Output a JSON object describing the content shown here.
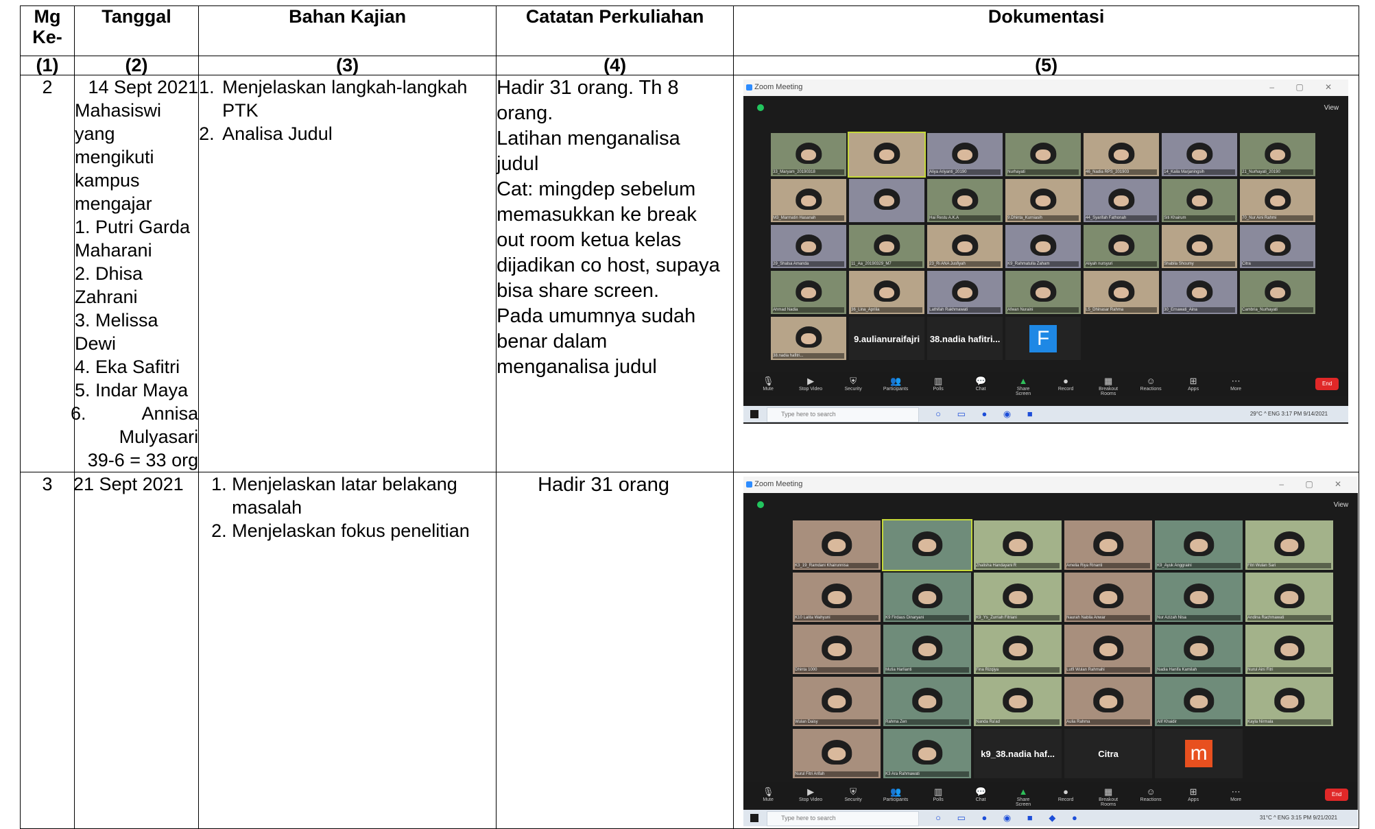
{
  "table": {
    "headers": [
      "Mg Ke-",
      "Tanggal",
      "Bahan Kajian",
      "Catatan Perkuliahan",
      "Dokumentasi"
    ],
    "col_numbers": [
      "(1)",
      "(2)",
      "(3)",
      "(4)",
      "(5)"
    ],
    "rows": [
      {
        "mg": "2",
        "tanggal_lines": [
          "14 Sept 2021",
          "Mahasiswi",
          "yang mengikuti",
          "kampus",
          "mengajar",
          "1. Putri Garda",
          "Maharani",
          "2. Dhisa",
          "Zahrani",
          "3. Melissa",
          "Dewi",
          "4. Eka Safitri",
          "5. Indar Maya",
          "6.           Annisa",
          "Mulyasari",
          "39-6 = 33 org"
        ],
        "bahan": [
          "Menjelaskan langkah-langkah PTK",
          "Analisa Judul"
        ],
        "catatan_lines": [
          "Hadir 31 orang. Th 8",
          "orang.",
          "Latihan menganalisa",
          "judul",
          "Cat: mingdep sebelum",
          "memasukkan ke break",
          "out room ketua kelas",
          "dijadikan co host, supaya",
          "bisa share screen.",
          "Pada umumnya sudah",
          "benar dalam",
          "menganalisa judul"
        ],
        "dokumentasi": {
          "window_title": "Zoom Meeting",
          "view_label": "View",
          "participants": [
            "33_Maryam_20190318",
            "",
            "Aliya Ariyanti_20190",
            "Nurhayati",
            "46_Nadia RPS_201903",
            "14_Kaila Marjaningsih",
            "21_Nurhayati_20190",
            "M3_Marmatin Hasanah",
            "",
            "Hai Restu A.K.A",
            "9.Dhinta_Kurniasih",
            "44_Syarifah Fathonah",
            "Siti Khairum",
            "70_Nur Aini Rahmi",
            "29_Shalsa Amanda",
            "11_Aa_20190329_M7",
            "23_Ri ANA Jusfiyah",
            "K9_Rahmatulla Zaham",
            "Aliyah nursyuri",
            "Shabila Shoumy",
            "Citra",
            "Ahmad Nadia",
            "36_Lina_Aprilia",
            "Lathifah Rakhmawati",
            "Afwan Nuraini",
            "L5_Dhinasar Rahma",
            "30_Ernawati_Aina",
            "Cambria_Nurhayati",
            "38.nadia hafitri..."
          ],
          "name_tiles": [
            "9.aulianuraifajri",
            "38.nadia hafitri..."
          ],
          "avatar_letter": "F",
          "controls": [
            "Mute",
            "Stop Video",
            "Security",
            "Participants",
            "Polls",
            "Chat",
            "Share Screen",
            "Record",
            "Breakout Rooms",
            "Reactions",
            "Apps",
            "More"
          ],
          "end_label": "End",
          "search_placeholder": "Type here to search",
          "tray": "29°C  ^  ENG  3:17 PM  9/14/2021"
        }
      },
      {
        "mg": "3",
        "tanggal_lines": [
          "21 Sept 2021"
        ],
        "bahan": [
          "Menjelaskan latar belakang masalah",
          "Menjelaskan fokus penelitian"
        ],
        "catatan_lines": [
          "Hadir 31 orang"
        ],
        "dokumentasi": {
          "window_title": "Zoom Meeting",
          "view_label": "View",
          "participants": [
            "K3_19_Ramdani Khairunnisa",
            "",
            "Zhalisha Handayani R",
            "Amelia Riya Rinanti",
            "K9_Ayuk Anggraini",
            "Fitri Wulan Sari",
            "K10 Lalita Wahyuni",
            "K9 Firdaus Dinaryani",
            "K9_Ys_Zurriah Fitriani",
            "Naurah Nabila Anwar",
            "Nur Azizah Nisa",
            "Andina Rachmawati",
            "Dhinta 1000",
            "Mutia Harlianti",
            "Fina Rizqiya",
            "Lutfi Wulan Rahmahi",
            "Nadia Hanifa Kamilah",
            "Nurul Aini Fitri",
            "Wulan Daisy",
            "Rahma Zen",
            "Nanda Ra'ad",
            "Aulia Rahma",
            "Alif Khaidir",
            "Kayla Nirmala",
            "Nurul Fitri Arifah",
            "K3 Ara Rahmawati"
          ],
          "name_tiles": [
            "k9_38.nadia haf...",
            "Citra"
          ],
          "avatar_letter": "m",
          "controls": [
            "Mute",
            "Stop Video",
            "Security",
            "Participants",
            "Polls",
            "Chat",
            "Share Screen",
            "Record",
            "Breakout Rooms",
            "Reactions",
            "Apps",
            "More"
          ],
          "end_label": "End",
          "search_placeholder": "Type here to search",
          "tray": "31°C  ^  ENG  3:15 PM  9/21/2021"
        }
      }
    ]
  },
  "colors": {
    "zoom_bg": "#1b1b1b",
    "share_green": "#2fbf5a",
    "end_red": "#e02828",
    "active_speaker": "#c6d93a",
    "avatar_blue": "#1e88e5",
    "avatar_orange": "#e8501f"
  }
}
